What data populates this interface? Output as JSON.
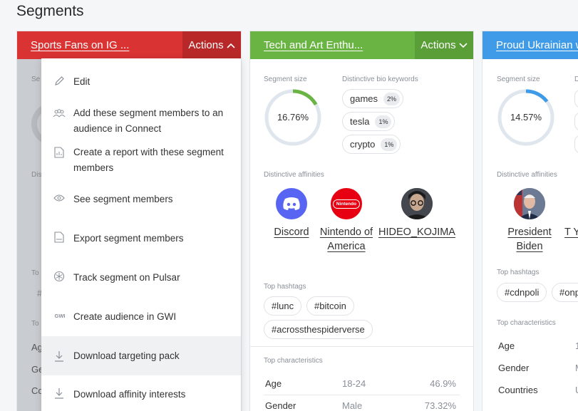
{
  "page": {
    "title": "Segments"
  },
  "cards": [
    {
      "name": "Sports Fans on IG ...",
      "actions_label": "Actions",
      "ghost": [
        "Se",
        "Dis",
        "To",
        "#",
        "To",
        "Ag",
        "Ge",
        "Co"
      ]
    },
    {
      "name": "Tech and Art Enthu...",
      "actions_label": "Actions",
      "segment_size_label": "Segment size",
      "segment_size": "16.76%",
      "segment_fraction": 0.1676,
      "bio_keywords_label": "Distinctive bio keywords",
      "keywords": [
        {
          "word": "games",
          "pct": "2%"
        },
        {
          "word": "tesla",
          "pct": "1%"
        },
        {
          "word": "crypto",
          "pct": "1%"
        }
      ],
      "affinities_label": "Distinctive affinities",
      "affinities": [
        "Discord",
        "Nintendo of America",
        "HIDEO_KOJIMA"
      ],
      "hashtags_label": "Top hashtags",
      "hashtags": [
        "#lunc",
        "#bitcoin",
        "#acrossthespiderverse"
      ],
      "characteristics_label": "Top characteristics",
      "characteristics": [
        {
          "key": "Age",
          "value": "18-24",
          "pct": "46.9%"
        },
        {
          "key": "Gender",
          "value": "Male",
          "pct": "73.32%"
        }
      ]
    },
    {
      "name": "Proud Ukrainian w",
      "segment_size_label": "Segment size",
      "segment_size": "14.57%",
      "segment_fraction": 0.1457,
      "bio_keywords_label": "D",
      "affinities_label": "Distinctive affinities",
      "affinities": [
        "President Biden",
        "T Yo"
      ],
      "hashtags_label": "Top hashtags",
      "hashtags": [
        "#cdnpoli",
        "#onp"
      ],
      "characteristics_label": "Top characteristics",
      "characteristics": [
        {
          "key": "Age",
          "value": "1"
        },
        {
          "key": "Gender",
          "value": "M"
        },
        {
          "key": "Countries",
          "value": "U"
        }
      ]
    }
  ],
  "menu": {
    "items": [
      {
        "label": "Edit",
        "icon": "pencil-icon"
      },
      {
        "label": "Add these segment members to an audience in Connect",
        "icon": "people-icon"
      },
      {
        "label": "Create a report with these segment members",
        "icon": "report-icon"
      },
      {
        "label": "See segment members",
        "icon": "eye-icon"
      },
      {
        "label": "Export segment members",
        "icon": "export-file-icon"
      },
      {
        "label": "Track segment on Pulsar",
        "icon": "pulsar-icon"
      },
      {
        "label": "Create audience in GWI",
        "icon": "gwi-icon",
        "icon_text": "GWI"
      },
      {
        "label": "Download targeting pack",
        "icon": "download-icon"
      },
      {
        "label": "Download affinity interests",
        "icon": "download-icon"
      }
    ]
  },
  "colors": {
    "red": "#d93334",
    "green": "#6ab443",
    "blue": "#3f9ae8"
  }
}
